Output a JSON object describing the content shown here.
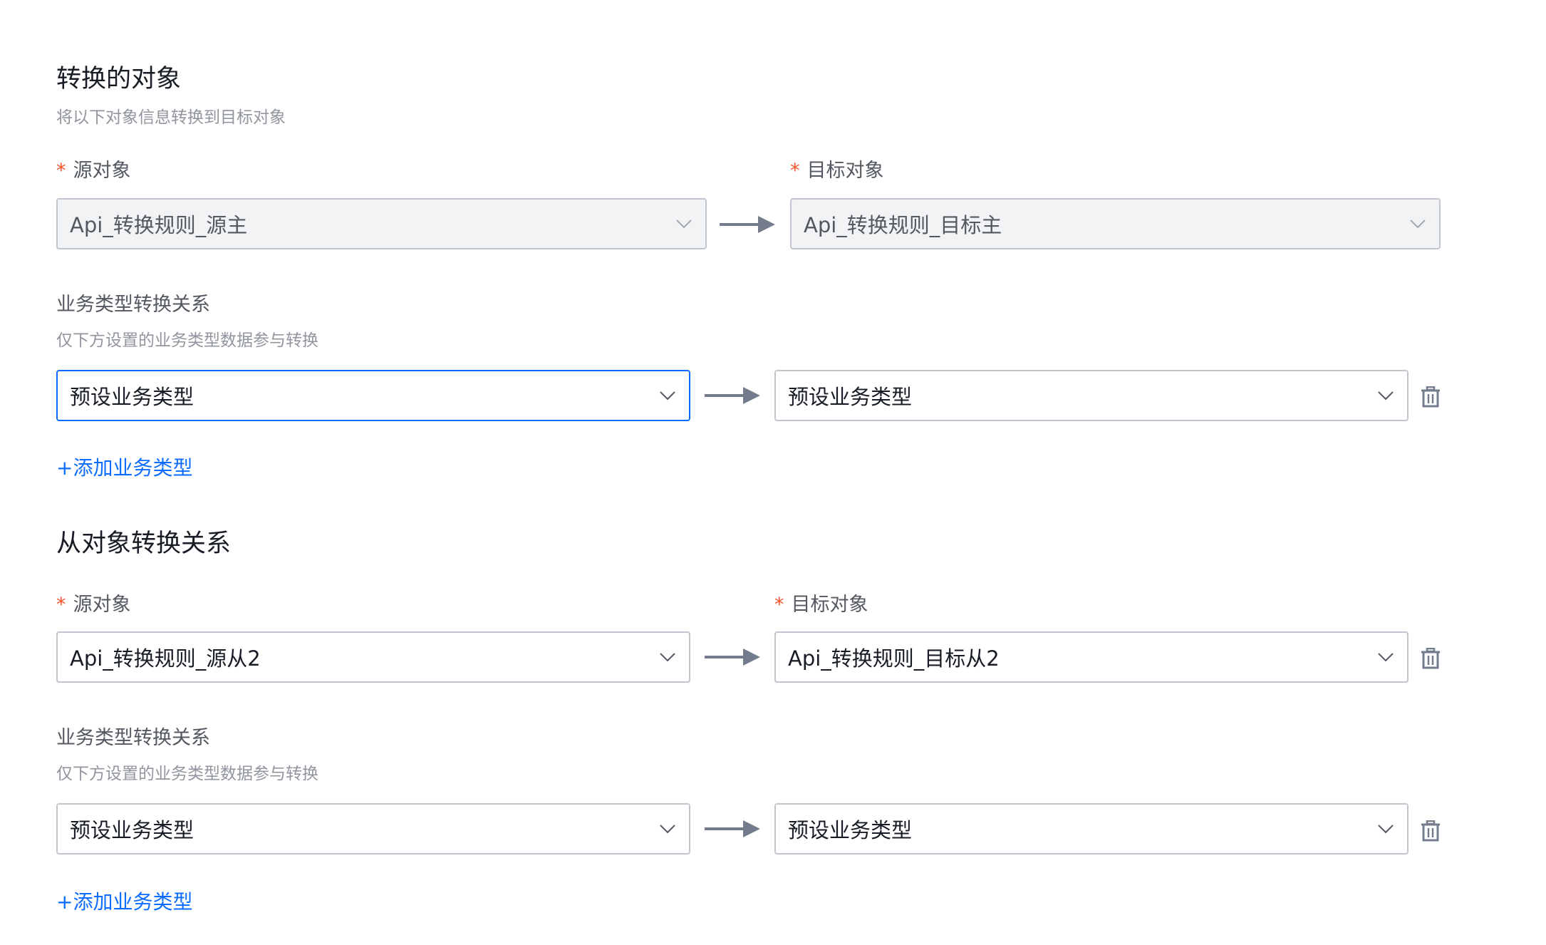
{
  "section_main": {
    "title": "转换的对象",
    "subtitle": "将以下对象信息转换到目标对象",
    "required_mark": "*",
    "source_label": "源对象",
    "target_label": "目标对象",
    "source_value": "Api_转换规则_源主",
    "target_value": "Api_转换规则_目标主",
    "biz_title": "业务类型转换关系",
    "biz_subtitle": "仅下方设置的业务类型数据参与转换",
    "biz_source_value": "预设业务类型",
    "biz_target_value": "预设业务类型",
    "add_biz_label": "+添加业务类型"
  },
  "section_detail": {
    "title": "从对象转换关系",
    "required_mark": "*",
    "source_label": "源对象",
    "target_label": "目标对象",
    "source_value": "Api_转换规则_源从2",
    "target_value": "Api_转换规则_目标从2",
    "biz_title": "业务类型转换关系",
    "biz_subtitle": "仅下方设置的业务类型数据参与转换",
    "biz_source_value": "预设业务类型",
    "biz_target_value": "预设业务类型",
    "add_biz_label": "+添加业务类型"
  },
  "icons": {
    "dropdown": "chevron-down-icon",
    "mapping": "arrow-right-icon",
    "delete": "trash-icon"
  },
  "colors": {
    "primary": "#0c6cff",
    "required": "#ff522a",
    "border": "#c1c5ce",
    "disabled_bg": "#f2f3f5",
    "muted_text": "#91959e"
  }
}
